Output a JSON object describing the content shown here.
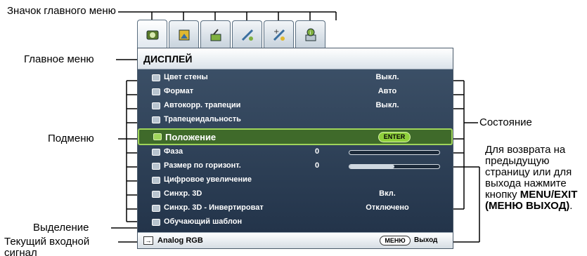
{
  "tabs": [
    {
      "name": "display-tab",
      "icon": "display-icon"
    },
    {
      "name": "picture-tab",
      "icon": "picture-icon"
    },
    {
      "name": "source-tab",
      "icon": "source-icon"
    },
    {
      "name": "system-setup-basic-tab",
      "icon": "system-setup-basic-icon"
    },
    {
      "name": "system-setup-advanced-tab",
      "icon": "system-setup-advanced-icon"
    },
    {
      "name": "information-tab",
      "icon": "information-icon"
    }
  ],
  "menu": {
    "title": "ДИСПЛЕЙ",
    "items": [
      {
        "label": "Цвет стены",
        "value": "Выкл."
      },
      {
        "label": "Формат",
        "value": "Авто"
      },
      {
        "label": "Автокорр. трапеции",
        "value": "Выкл."
      },
      {
        "label": "Трапецеидальность",
        "value": ""
      },
      {
        "label": "Положение",
        "value": "ENTER"
      },
      {
        "label": "Фаза",
        "value": "0",
        "level": 0.0
      },
      {
        "label": "Размер по горизонт.",
        "value": "0",
        "level": 0.5
      },
      {
        "label": "Цифровое увеличение",
        "value": ""
      },
      {
        "label": "Синхр. 3D",
        "value": "Вкл."
      },
      {
        "label": "Синхр. 3D - Инвертироват",
        "value": "Отключено"
      },
      {
        "label": "Обучающий шаблон",
        "value": ""
      }
    ]
  },
  "status_bar": {
    "source": "Analog RGB",
    "menu_button": "МЕНЮ",
    "exit_label": "Выход"
  },
  "annotations": {
    "main_menu_icon": "Значок главного меню",
    "main_menu": "Главное меню",
    "submenu": "Подменю",
    "highlight": "Выделение",
    "current_input": "Текущий входной сигнал",
    "status": "Состояние",
    "return_prefix": "Для возврата на предыдущую страницу или для выхода нажмите кнопку",
    "return_button": "MENU/EXIT (МЕНЮ ВЫХОД)",
    "return_suffix": "."
  },
  "colors": {
    "menu_bg": "#2e4258",
    "highlight_bg": "#3f6a2a",
    "highlight_border": "#9fd45a",
    "enter_badge": "#8fd03c"
  }
}
